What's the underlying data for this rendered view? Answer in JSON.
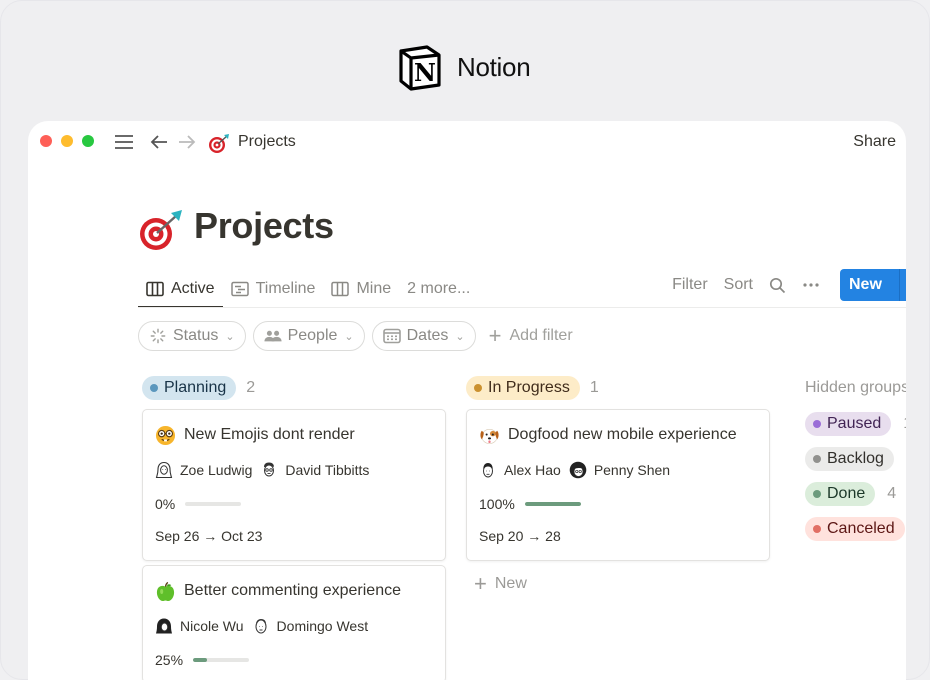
{
  "brand": {
    "name": "Notion",
    "logo_icon": "notion-logo-icon"
  },
  "window": {
    "controls": [
      "close",
      "minimize",
      "maximize"
    ],
    "breadcrumb": {
      "icon": "dart-target-emoji",
      "label": "Projects"
    },
    "share_label": "Share"
  },
  "page": {
    "icon": "dart-target-emoji",
    "title": "Projects"
  },
  "views": {
    "tabs": [
      {
        "label": "Active",
        "icon": "board-icon",
        "active": true
      },
      {
        "label": "Timeline",
        "icon": "timeline-icon",
        "active": false
      },
      {
        "label": "Mine",
        "icon": "board-icon",
        "active": false
      },
      {
        "label": "2 more...",
        "icon": null,
        "active": false
      }
    ],
    "actions": {
      "filter_label": "Filter",
      "sort_label": "Sort",
      "search_icon": "search-icon",
      "more_icon": "ellipsis-icon",
      "new_label": "New"
    }
  },
  "filters": {
    "chips": [
      {
        "label": "Status",
        "icon": "status-spinner-icon"
      },
      {
        "label": "People",
        "icon": "people-icon"
      },
      {
        "label": "Dates",
        "icon": "calendar-icon"
      }
    ],
    "add_filter_label": "Add filter"
  },
  "board": {
    "groups": [
      {
        "label": "Planning",
        "count": "2",
        "color": {
          "bg": "#d3e5ef",
          "dot": "#5b97bd",
          "text": "#183347"
        },
        "cards": [
          {
            "emoji": "nerd-face-emoji",
            "title": "New Emojis dont  render",
            "people": [
              {
                "name": "Zoe Ludwig",
                "avatar": "avatar-zoe"
              },
              {
                "name": "David Tibbitts",
                "avatar": "avatar-david"
              }
            ],
            "progress_label": "0%",
            "progress": 0,
            "dates": "Sep 26 → Oct 23"
          },
          {
            "emoji": "green-apple-emoji",
            "title": "Better commenting experience",
            "people": [
              {
                "name": "Nicole Wu",
                "avatar": "avatar-nicole"
              },
              {
                "name": "Domingo West",
                "avatar": "avatar-domingo"
              }
            ],
            "progress_label": "25%",
            "progress": 0.25,
            "dates": ""
          }
        ]
      },
      {
        "label": "In Progress",
        "count": "1",
        "color": {
          "bg": "#fdecc8",
          "dot": "#cb912f",
          "text": "#402c1b"
        },
        "cards": [
          {
            "emoji": "dog-face-emoji",
            "title": "Dogfood new mobile experience",
            "people": [
              {
                "name": "Alex Hao",
                "avatar": "avatar-alex"
              },
              {
                "name": "Penny Shen",
                "avatar": "avatar-penny"
              }
            ],
            "progress_label": "100%",
            "progress": 1,
            "dates": "Sep 20 → 28"
          }
        ],
        "add_new_label": "New"
      }
    ],
    "hidden_groups": {
      "title": "Hidden groups",
      "items": [
        {
          "label": "Paused",
          "count": "1",
          "color": {
            "bg": "#e8deee",
            "dot": "#9a6dd7",
            "text": "#412454"
          }
        },
        {
          "label": "Backlog",
          "count": "",
          "color": {
            "bg": "#ebebea",
            "dot": "#91918e",
            "text": "#32302c"
          }
        },
        {
          "label": "Done",
          "count": "4",
          "color": {
            "bg": "#dbeddb",
            "dot": "#6c9b7d",
            "text": "#1c3829"
          }
        },
        {
          "label": "Canceled",
          "count": "",
          "color": {
            "bg": "#ffe2dd",
            "dot": "#e16f64",
            "text": "#5d1715"
          }
        }
      ]
    }
  }
}
